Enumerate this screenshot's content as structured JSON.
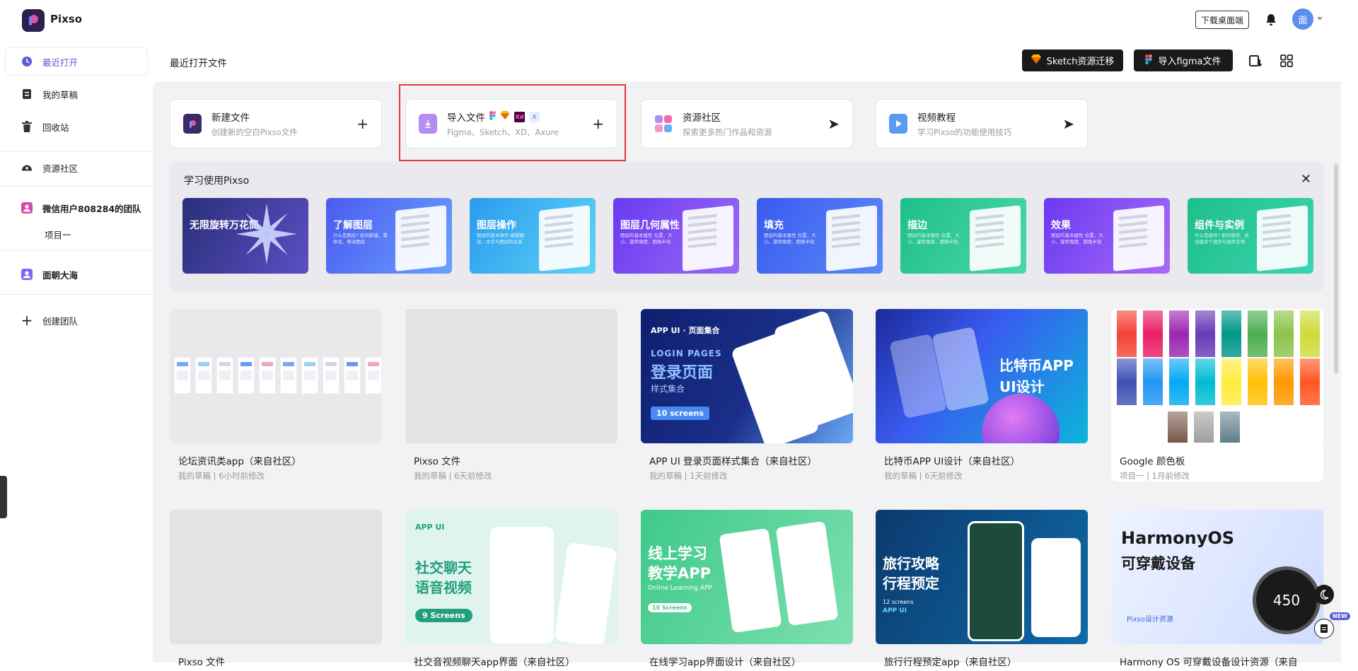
{
  "app": {
    "name": "Pixso",
    "download_label": "下载桌面端",
    "avatar_text": "面"
  },
  "sidebar": {
    "items": [
      {
        "label": "最近打开",
        "icon": "clock-icon",
        "active": true
      },
      {
        "label": "我的草稿",
        "icon": "draft-icon"
      },
      {
        "label": "回收站",
        "icon": "trash-icon"
      },
      {
        "label": "资源社区",
        "icon": "community-icon"
      }
    ],
    "team": {
      "label": "微信用户808284的团队",
      "project": "项目一"
    },
    "team2": {
      "label": "面朝大海"
    },
    "create_team": "创建团队"
  },
  "header": {
    "title": "最近打开文件",
    "sketch_label": "Sketch资源迁移",
    "figma_label": "导入figma文件"
  },
  "actions": [
    {
      "title": "新建文件",
      "sub": "创建新的空白Pixso文件",
      "trail": "+",
      "color": "#3d2a68"
    },
    {
      "title": "导入文件",
      "sub": "Figma、Sketch、XD、Axure",
      "trail": "+",
      "color": "#b58cf0"
    },
    {
      "title": "资源社区",
      "sub": "探索更多热门作品和资源",
      "trail": "➤",
      "color": "#d36fc9"
    },
    {
      "title": "视频教程",
      "sub": "学习Pixso的功能使用技巧",
      "trail": "➤",
      "color": "#5a9af0"
    }
  ],
  "learn": {
    "title": "学习使用Pixso",
    "cards": [
      {
        "title": "无限旋转万花筒",
        "sub": "",
        "c1": "#2a2f7a",
        "c2": "#5b4fc4"
      },
      {
        "title": "了解图层",
        "sub": "什么是图层? 如何新建、重命名、移动图层",
        "c1": "#4a5bf0",
        "c2": "#6aa0ff"
      },
      {
        "title": "图层操作",
        "sub": "图层的基本操作 编辑图层、文字与图层的关系",
        "c1": "#2a9bf0",
        "c2": "#5ed4f5"
      },
      {
        "title": "图层几何属性",
        "sub": "图层的基本属性 位置、大小、旋转角度、圆角半径",
        "c1": "#6a3af0",
        "c2": "#9a6af8"
      },
      {
        "title": "填充",
        "sub": "图层的基本属性 位置、大小、旋转角度、圆角半径",
        "c1": "#3a5af0",
        "c2": "#5a8af8"
      },
      {
        "title": "描边",
        "sub": "图层的基本属性 位置、大小、旋转角度、圆角半径",
        "c1": "#1fbf8a",
        "c2": "#4bd8a8"
      },
      {
        "title": "效果",
        "sub": "图层的基本属性 位置、大小、旋转角度、圆角半径",
        "c1": "#6a3af0",
        "c2": "#a86af8"
      },
      {
        "title": "组件与实例",
        "sub": "什么是组件? 如何使用、并创建多个组件与组件实例",
        "c1": "#1fbf8a",
        "c2": "#3bd4b0"
      }
    ]
  },
  "files": [
    {
      "name": "论坛资讯类app（来自社区）",
      "meta": "我的草稿 | 6小时前修改",
      "type": "screens"
    },
    {
      "name": "Pixso 文件",
      "meta": "我的草稿 | 6天前修改",
      "type": "blank"
    },
    {
      "name": "APP UI 登录页面样式集合（来自社区）",
      "meta": "我的草稿 | 1天前修改",
      "type": "login",
      "t1": "APP UI · 页面集合",
      "t2": "LOGIN PAGES",
      "t3": "登录页面",
      "t4": "样式集合",
      "t5": "10 screens"
    },
    {
      "name": "比特币APP UI设计（来自社区）",
      "meta": "我的草稿 | 6天前修改",
      "type": "bitcoin",
      "t1": "比特币APP",
      "t2": "UI设计"
    },
    {
      "name": "Google 颜色板",
      "meta": "项目一 | 1月前修改",
      "type": "palette"
    },
    {
      "name": "Pixso 文件",
      "meta": "",
      "type": "blank"
    },
    {
      "name": "社交音视频聊天app界面（来自社区）",
      "meta": "",
      "type": "social",
      "t1": "APP UI",
      "t2": "社交聊天",
      "t3": "语音视频",
      "t4": "9 Screens"
    },
    {
      "name": "在线学习app界面设计（来自社区）",
      "meta": "",
      "type": "learning",
      "t1": "线上学习",
      "t2": "教学APP",
      "t3": "Online Learning APP",
      "t4": "10 Screens"
    },
    {
      "name": "旅行行程预定app（来自社区）",
      "meta": "",
      "type": "travel",
      "t1": "旅行攻略",
      "t2": "行程预定",
      "t3": "12 screens",
      "t4": "APP UI"
    },
    {
      "name": "Harmony OS 可穿戴设备设计资源（来自",
      "meta": "",
      "type": "harmony",
      "t1": "HarmonyOS",
      "t2": "可穿戴设备",
      "t3": "Pixso设计资源",
      "t4": "450"
    }
  ],
  "floating": {
    "new_badge": "NEW"
  }
}
